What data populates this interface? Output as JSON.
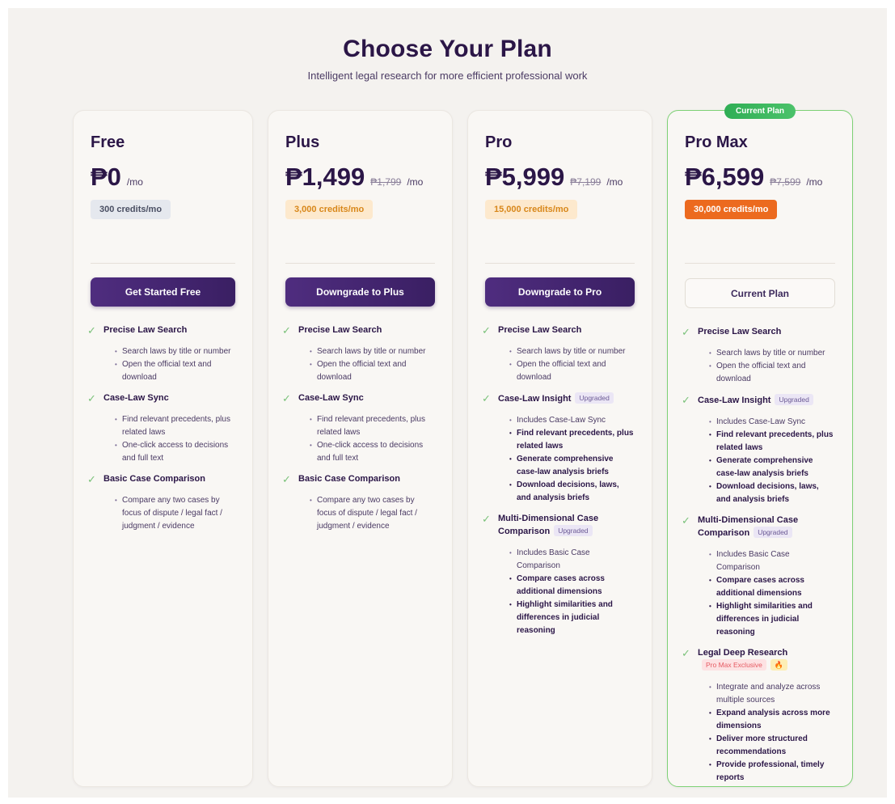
{
  "header": {
    "title": "Choose Your Plan",
    "subtitle": "Intelligent legal research for more efficient professional work"
  },
  "colors": {
    "primary": "#3a1f63",
    "current_border": "#7ed175",
    "current_badge": "#2fae55",
    "check": "#7bc27a",
    "credits_free": "#e5e8ee",
    "credits_paid": "#fde9cd",
    "credits_max": "#ec6a1f"
  },
  "plans": [
    {
      "name": "Free",
      "price": "₱0",
      "old_price": "",
      "period": "/mo",
      "credits": "300 credits/mo",
      "cta": "Get Started Free",
      "features": [
        {
          "title": "Precise Law Search",
          "items": [
            {
              "text": "Search laws by title or number"
            },
            {
              "text": "Open the official text and download"
            }
          ]
        },
        {
          "title": "Case-Law Sync",
          "items": [
            {
              "text": "Find relevant precedents, plus related laws"
            },
            {
              "text": "One-click access to decisions and full text"
            }
          ]
        },
        {
          "title": "Basic Case Comparison",
          "items": [
            {
              "text": "Compare any two cases by focus of dispute / legal fact / judgment / evidence"
            }
          ]
        }
      ]
    },
    {
      "name": "Plus",
      "price": "₱1,499",
      "old_price": "₱1,799",
      "period": "/mo",
      "credits": "3,000 credits/mo",
      "cta": "Downgrade to Plus",
      "features": [
        {
          "title": "Precise Law Search",
          "items": [
            {
              "text": "Search laws by title or number"
            },
            {
              "text": "Open the official text and download"
            }
          ]
        },
        {
          "title": "Case-Law Sync",
          "items": [
            {
              "text": "Find relevant precedents, plus related laws"
            },
            {
              "text": "One-click access to decisions and full text"
            }
          ]
        },
        {
          "title": "Basic Case Comparison",
          "items": [
            {
              "text": "Compare any two cases by focus of dispute / legal fact / judgment / evidence"
            }
          ]
        }
      ]
    },
    {
      "name": "Pro",
      "price": "₱5,999",
      "old_price": "₱7,199",
      "period": "/mo",
      "credits": "15,000 credits/mo",
      "cta": "Downgrade to Pro",
      "features": [
        {
          "title": "Precise Law Search",
          "items": [
            {
              "text": "Search laws by title or number"
            },
            {
              "text": "Open the official text and download"
            }
          ]
        },
        {
          "title": "Case-Law Insight",
          "tag": "Upgraded",
          "items": [
            {
              "text": "Includes Case-Law Sync"
            },
            {
              "text": "Find relevant precedents, plus related laws",
              "bold": true
            },
            {
              "text": "Generate comprehensive case-law analysis briefs",
              "bold": true
            },
            {
              "text": "Download decisions, laws, and analysis briefs",
              "bold": true
            }
          ]
        },
        {
          "title": "Multi-Dimensional Case Comparison",
          "tag": "Upgraded",
          "items": [
            {
              "text": "Includes Basic Case Comparison"
            },
            {
              "text": "Compare cases across additional dimensions",
              "bold": true
            },
            {
              "text": "Highlight similarities and differences in judicial reasoning",
              "bold": true
            }
          ]
        }
      ]
    },
    {
      "name": "Pro Max",
      "price": "₱6,599",
      "old_price": "₱7,599",
      "period": "/mo",
      "credits": "30,000 credits/mo",
      "cta": "Current Plan",
      "badge": "Current Plan",
      "features": [
        {
          "title": "Precise Law Search",
          "items": [
            {
              "text": "Search laws by title or number"
            },
            {
              "text": "Open the official text and download"
            }
          ]
        },
        {
          "title": "Case-Law Insight",
          "tag": "Upgraded",
          "items": [
            {
              "text": "Includes Case-Law Sync"
            },
            {
              "text": "Find relevant precedents, plus related laws",
              "bold": true
            },
            {
              "text": "Generate comprehensive case-law analysis briefs",
              "bold": true
            },
            {
              "text": "Download decisions, laws, and analysis briefs",
              "bold": true
            }
          ]
        },
        {
          "title": "Multi-Dimensional Case Comparison",
          "tag": "Upgraded",
          "items": [
            {
              "text": "Includes Basic Case Comparison"
            },
            {
              "text": "Compare cases across additional dimensions",
              "bold": true
            },
            {
              "text": "Highlight similarities and differences in judicial reasoning",
              "bold": true
            }
          ]
        },
        {
          "title": "Legal Deep Research",
          "tag": "Pro Max Exclusive",
          "emoji": "🔥",
          "items": [
            {
              "text": "Integrate and analyze across multiple sources"
            },
            {
              "text": "Expand analysis across more dimensions",
              "bold": true
            },
            {
              "text": "Deliver more structured recommendations",
              "bold": true
            },
            {
              "text": "Provide professional, timely reports",
              "bold": true
            }
          ]
        }
      ]
    }
  ]
}
